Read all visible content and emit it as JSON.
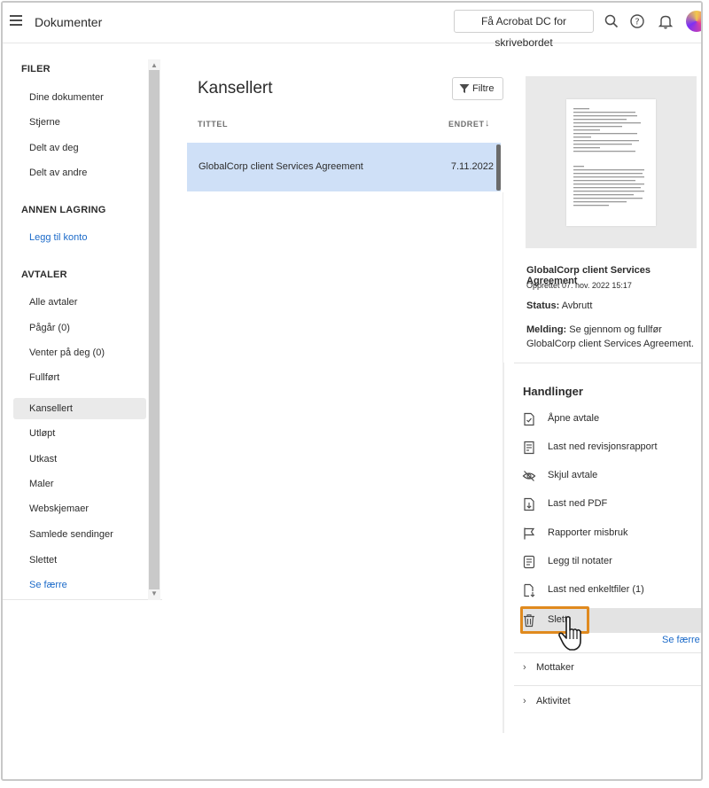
{
  "topbar": {
    "title": "Dokumenter",
    "acrobat_button": "Få Acrobat DC for skrivebordet",
    "icons": [
      "menu-icon",
      "search-icon",
      "help-icon",
      "bell-icon",
      "avatar"
    ]
  },
  "sidebar": {
    "section_files": "FILER",
    "files_items": [
      {
        "label": "Dine dokumenter"
      },
      {
        "label": "Stjerne"
      },
      {
        "label": "Delt av deg"
      },
      {
        "label": "Delt av andre"
      }
    ],
    "section_other": "ANNEN LAGRING",
    "add_account": "Legg til konto",
    "section_agreements": "AVTALER",
    "agreement_items": [
      {
        "label": "Alle avtaler"
      },
      {
        "label": "Pågår (0)"
      },
      {
        "label": "Venter på deg (0)"
      },
      {
        "label": "Fullført"
      },
      {
        "label": "Kansellert",
        "active": true
      },
      {
        "label": "Utløpt"
      },
      {
        "label": "Utkast"
      },
      {
        "label": "Maler"
      },
      {
        "label": "Webskjemaer"
      },
      {
        "label": "Samlede sendinger"
      },
      {
        "label": "Slettet"
      }
    ],
    "see_fewer": "Se færre"
  },
  "list": {
    "title": "Kansellert",
    "filter_label": "Filtre",
    "col_title": "TITTEL",
    "col_modified": "ENDRET",
    "rows": [
      {
        "name": "GlobalCorp client Services Agreement",
        "date": "7.11.2022",
        "selected": true
      }
    ]
  },
  "details": {
    "doc_name": "GlobalCorp client Services Agreement",
    "created": "Opprettet 07. nov. 2022 15:17",
    "status_label": "Status:",
    "status_value": "Avbrutt",
    "message_label": "Melding:",
    "message_value": "Se gjennom og fullfør GlobalCorp client Services Agreement.",
    "actions_title": "Handlinger",
    "actions": [
      {
        "label": "Åpne avtale",
        "icon": "open-agreement-icon"
      },
      {
        "label": "Last ned revisjonsrapport",
        "icon": "audit-report-icon"
      },
      {
        "label": "Skjul avtale",
        "icon": "hide-icon"
      },
      {
        "label": "Last ned PDF",
        "icon": "download-pdf-icon"
      },
      {
        "label": "Rapporter misbruk",
        "icon": "flag-icon"
      },
      {
        "label": "Legg til notater",
        "icon": "notes-icon"
      },
      {
        "label": "Last ned enkeltfiler (1)",
        "icon": "download-files-icon"
      },
      {
        "label": "Slett",
        "icon": "trash-icon",
        "hover": true
      }
    ],
    "see_fewer": "Se færre",
    "recipients": "Mottaker",
    "activity": "Aktivitet"
  },
  "colors": {
    "selected_row": "#cfe0f7",
    "link": "#1b6ac9",
    "highlight": "#e08a1e"
  }
}
